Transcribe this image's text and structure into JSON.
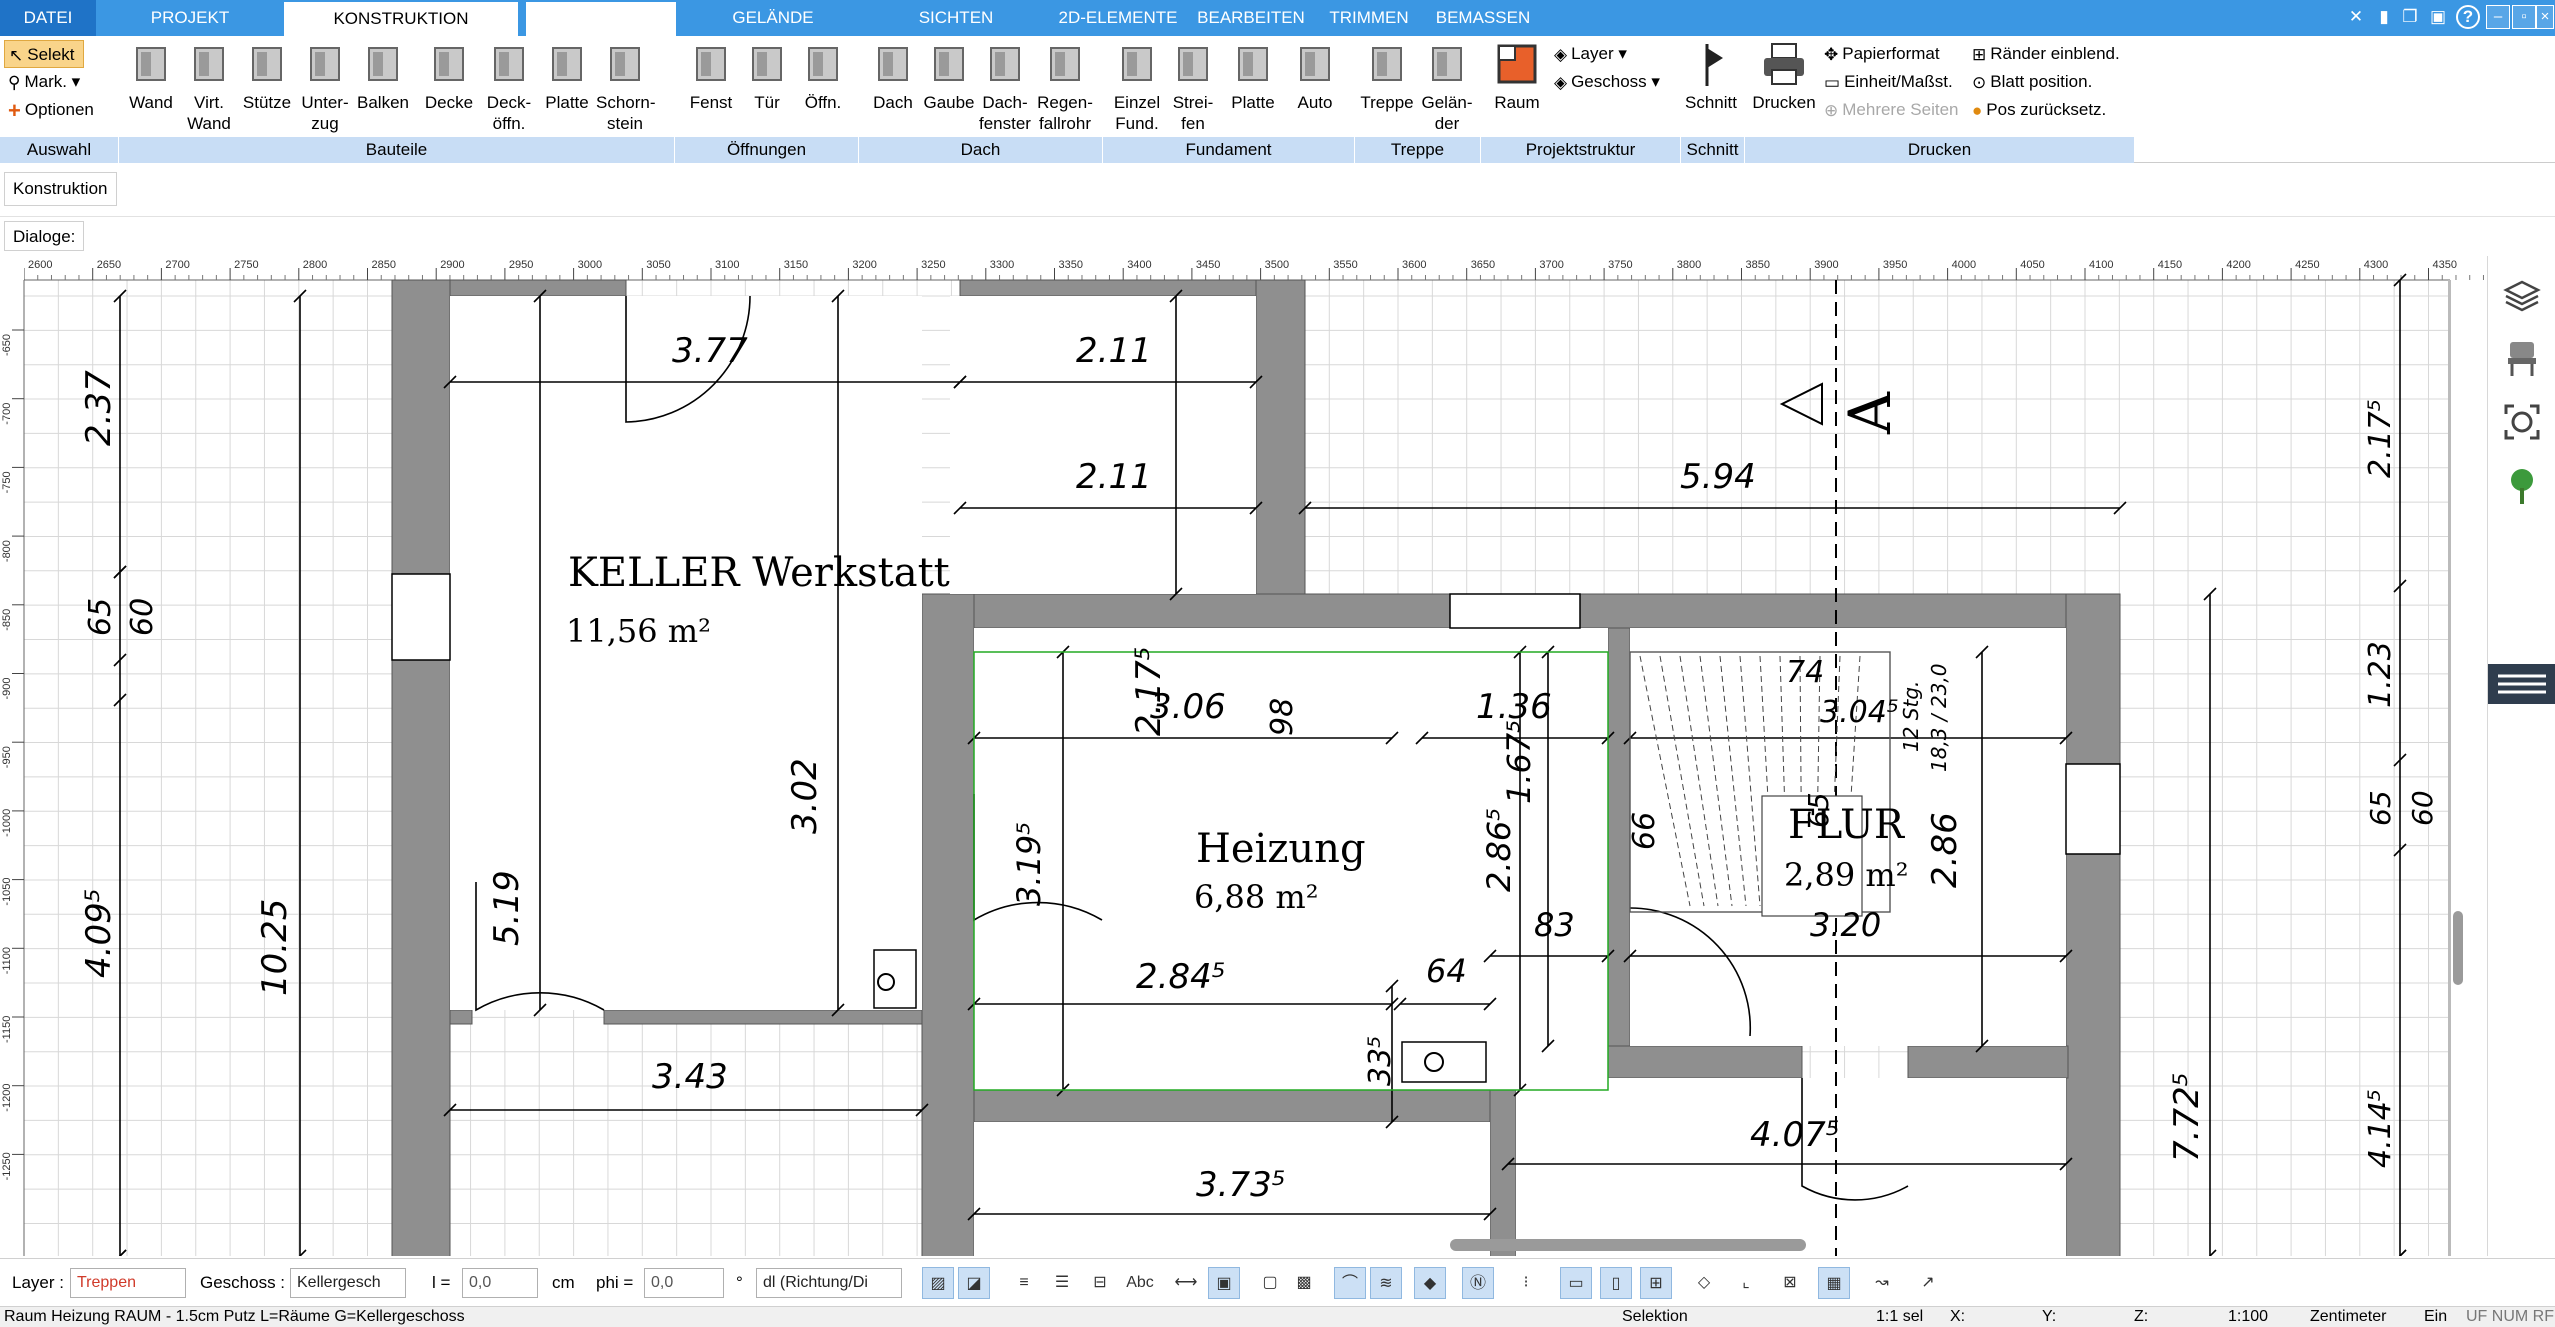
{
  "tabs": [
    {
      "label": "DATEI"
    },
    {
      "label": "PROJEKT"
    },
    {
      "label": "KONSTRUKTION"
    },
    {
      "label": ""
    },
    {
      "label": "GELÄNDE"
    },
    {
      "label": "SICHTEN"
    },
    {
      "label": "2D-ELEMENTE"
    },
    {
      "label": "BEARBEITEN"
    },
    {
      "label": "TRIMMEN"
    },
    {
      "label": "BEMASSEN"
    }
  ],
  "ribbon": {
    "auswahl": {
      "label": "Auswahl",
      "selekt": "Selekt",
      "mark": "Mark.",
      "optionen": "Optionen"
    },
    "bauteile": {
      "label": "Bauteile",
      "items": [
        {
          "l1": "Wand",
          "l2": ""
        },
        {
          "l1": "Virt.",
          "l2": "Wand"
        },
        {
          "l1": "Stütze",
          "l2": ""
        },
        {
          "l1": "Unter-",
          "l2": "zug"
        },
        {
          "l1": "Balken",
          "l2": ""
        },
        {
          "l1": "Decke",
          "l2": ""
        },
        {
          "l1": "Deck-",
          "l2": "öffn."
        },
        {
          "l1": "Platte",
          "l2": ""
        },
        {
          "l1": "Schorn-",
          "l2": "stein"
        }
      ]
    },
    "oeffnungen": {
      "label": "Öffnungen",
      "items": [
        {
          "l1": "Fenst",
          "l2": ""
        },
        {
          "l1": "Tür",
          "l2": ""
        },
        {
          "l1": "Öffn.",
          "l2": ""
        }
      ]
    },
    "dach": {
      "label": "Dach",
      "items": [
        {
          "l1": "Dach",
          "l2": ""
        },
        {
          "l1": "Gaube",
          "l2": ""
        },
        {
          "l1": "Dach-",
          "l2": "fenster"
        },
        {
          "l1": "Regen-",
          "l2": "fallrohr"
        }
      ]
    },
    "fundament": {
      "label": "Fundament",
      "items": [
        {
          "l1": "Einzel",
          "l2": "Fund."
        },
        {
          "l1": "Strei-",
          "l2": "fen"
        },
        {
          "l1": "Platte",
          "l2": ""
        },
        {
          "l1": "Auto",
          "l2": ""
        }
      ]
    },
    "treppe": {
      "label": "Treppe",
      "items": [
        {
          "l1": "Treppe",
          "l2": ""
        },
        {
          "l1": "Gelän-",
          "l2": "der"
        }
      ]
    },
    "projektstruktur": {
      "label": "Projektstruktur",
      "raum": "Raum",
      "layer": "Layer",
      "geschoss": "Geschoss"
    },
    "schnitt": {
      "label": "Schnitt",
      "item": "Schnitt"
    },
    "drucken": {
      "label": "Drucken",
      "item": "Drucken",
      "papierformat": "Papierformat",
      "einheit": "Einheit/Maßst.",
      "mehrere": "Mehrere Seiten",
      "raender": "Ränder einblend.",
      "blatt": "Blatt position.",
      "pos": "Pos zurücksetz."
    }
  },
  "construction_tab": "Konstruktion",
  "dialoge_label": "Dialoge:",
  "ruler": {
    "labels": [
      "2600",
      "2650",
      "2700",
      "2750",
      "2800",
      "2850",
      "2900",
      "2950",
      "3000",
      "3050",
      "3100",
      "3150",
      "3200",
      "3250",
      "3300",
      "3350",
      "3400",
      "3450",
      "3500",
      "3550",
      "3600",
      "3650",
      "3700",
      "3750",
      "3800",
      "3850",
      "3900",
      "3950",
      "4000",
      "4050",
      "4100",
      "4150",
      "4200",
      "4250",
      "4300",
      "4350"
    ],
    "vlabels": [
      "-650",
      "-700",
      "-750",
      "-800",
      "-850",
      "-900",
      "-950",
      "-1000",
      "-1050",
      "-1100",
      "-1150",
      "-1200",
      "-1250"
    ]
  },
  "plan": {
    "rooms": [
      {
        "name": "KELLER Werkstatt",
        "area": "11,56 m²"
      },
      {
        "name": "Heizung",
        "area": "6,88 m²"
      },
      {
        "name": "FLUR",
        "area": "2,89 m²"
      }
    ],
    "section_label": "A",
    "stair_labels": [
      "12 Stg.",
      "18,3 / 23,0"
    ],
    "dims": {
      "d377": "3.77",
      "d211a": "2.11",
      "d2175": "2.17⁵",
      "d211b": "2.11",
      "d594": "5.94",
      "d519": "5.19",
      "d306": "3.06",
      "d98": "98",
      "d136": "1.36",
      "d1675": "1.67⁵",
      "d74": "74",
      "d304": "3.04⁵",
      "d302": "3.02",
      "d3195": "3.19⁵",
      "d2865": "2.86⁵",
      "d66": "66",
      "d65b": "65",
      "d286": "2.86",
      "d83": "83",
      "d320": "3.20",
      "d2845": "2.84⁵",
      "d64": "64",
      "d335": "33⁵",
      "d343": "3.43",
      "d4075": "4.07⁵",
      "d3735": "3.73⁵",
      "d237": "2.37",
      "d65": "65",
      "d60": "60",
      "d4095": "4.09⁵",
      "d1025": "10.25",
      "d772": "7.72⁵",
      "rd2175": "2.17⁵",
      "rd123": "1.23",
      "rd65": "65",
      "rd60": "60",
      "rd4145": "4.14⁵"
    }
  },
  "status": {
    "layer_label": "Layer :",
    "layer_value": "Treppen",
    "geschoss_label": "Geschoss :",
    "geschoss_value": "Kellergesch",
    "l_label": "l =",
    "l_value": "0,0",
    "l_unit": "cm",
    "phi_label": "phi =",
    "phi_value": "0,0",
    "phi_unit": "°",
    "dl_value": "dl (Richtung/Di"
  },
  "bottom": {
    "info": "Raum Heizung RAUM - 1.5cm Putz L=Räume G=Kellergeschoss",
    "mode": "Selektion",
    "sel": "1:1 sel",
    "x": "X:",
    "y": "Y:",
    "z": "Z:",
    "scale": "1:100",
    "unit": "Zentimeter",
    "ein": "Ein",
    "flags": "UF NUM RF"
  },
  "colors": {
    "accent": "#3b97e3",
    "ribbon_label": "#c8ddf5",
    "wall": "#8f8f8f",
    "grid": "#d6d6d6"
  }
}
